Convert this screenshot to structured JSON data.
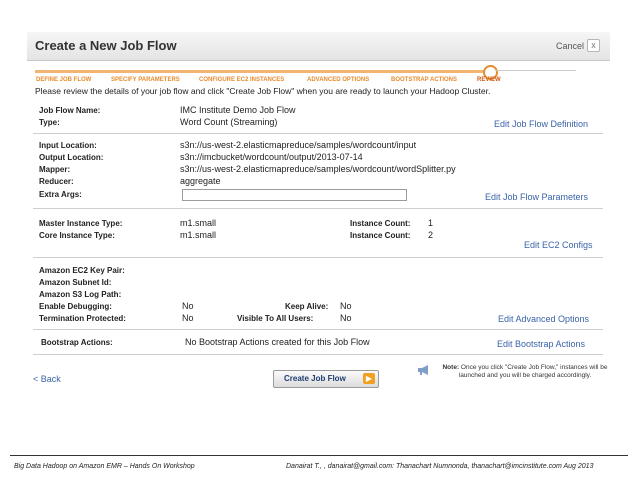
{
  "dialog": {
    "title": "Create a New Job Flow",
    "cancel_label": "Cancel",
    "close_glyph": "x"
  },
  "steps": [
    {
      "label": "DEFINE JOB FLOW"
    },
    {
      "label": "SPECIFY PARAMETERS"
    },
    {
      "label": "CONFIGURE EC2 INSTANCES"
    },
    {
      "label": "ADVANCED OPTIONS"
    },
    {
      "label": "BOOTSTRAP ACTIONS"
    },
    {
      "label": "REVIEW"
    }
  ],
  "instructions": "Please review the details of your job flow and click \"Create Job Flow\" when you are ready to launch your Hadoop Cluster.",
  "job_flow": {
    "name_label": "Job Flow Name:",
    "name_value": "IMC Institute Demo Job Flow",
    "type_label": "Type:",
    "type_value": "Word Count (Streaming)",
    "edit_label": "Edit Job Flow Definition"
  },
  "parameters": {
    "input_label": "Input Location:",
    "input_value": "s3n://us-west-2.elasticmapreduce/samples/wordcount/input",
    "output_label": "Output Location:",
    "output_value": "s3n://imcbucket/wordcount/output/2013-07-14",
    "mapper_label": "Mapper:",
    "mapper_value": "s3n://us-west-2.elasticmapreduce/samples/wordcount/wordSplitter.py",
    "reducer_label": "Reducer:",
    "reducer_value": "aggregate",
    "extra_label": "Extra Args:",
    "extra_value": "",
    "edit_label": "Edit Job Flow Parameters"
  },
  "ec2": {
    "master_label": "Master Instance Type:",
    "master_value": "m1.small",
    "core_label": "Core Instance Type:",
    "core_value": "m1.small",
    "master_count_label": "Instance Count:",
    "master_count_value": "1",
    "core_count_label": "Instance Count:",
    "core_count_value": "2",
    "edit_label": "Edit EC2 Configs"
  },
  "advanced": {
    "key_pair_label": "Amazon EC2 Key Pair:",
    "subnet_label": "Amazon Subnet Id:",
    "log_path_label": "Amazon S3 Log Path:",
    "debugging_label": "Enable Debugging:",
    "debugging_value": "No",
    "termination_label": "Termination Protected:",
    "termination_value": "No",
    "keep_alive_label": "Keep Alive:",
    "keep_alive_value": "No",
    "visible_label": "Visible To All Users:",
    "visible_value": "No",
    "edit_label": "Edit Advanced Options"
  },
  "bootstrap": {
    "label": "Bootstrap Actions:",
    "value": "No Bootstrap Actions created for this Job Flow",
    "edit_label": "Edit Bootstrap Actions"
  },
  "actions": {
    "back_label": "< Back",
    "create_label": "Create Job Flow",
    "create_arrow": "▶"
  },
  "note": {
    "bold": "Note:",
    "text": " Once you click \"Create Job Flow,\" instances will be launched and you will be charged accordingly."
  },
  "footer": {
    "left": "Big Data Hadoop on Amazon EMR – Hands On Workshop",
    "right": "Danairat T., , danairat@gmail.com:  Thanachart Numnonda,  thanachart@imcinstitute.com  Aug 2013"
  },
  "colors": {
    "accent_orange": "#e98a2a",
    "link_blue": "#3a64a8"
  }
}
